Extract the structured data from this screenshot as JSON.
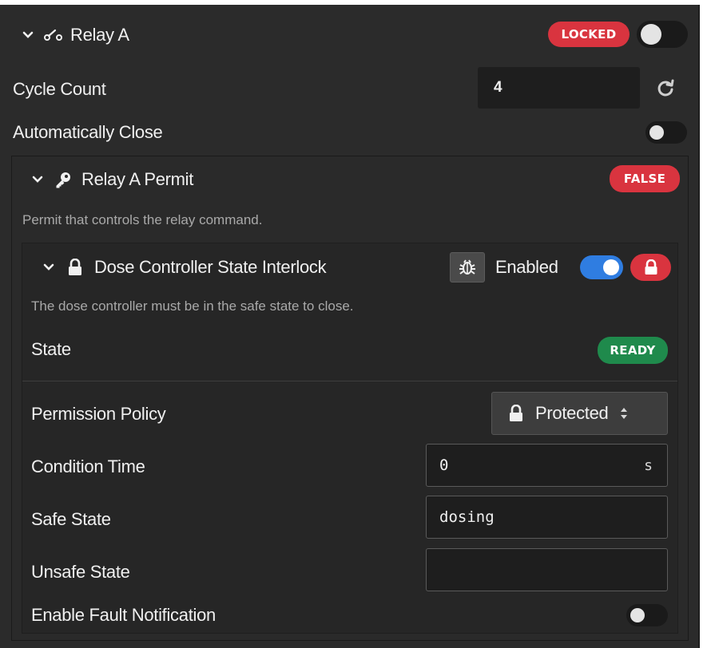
{
  "relay": {
    "title": "Relay A",
    "status_badge": "LOCKED",
    "cycle_count_label": "Cycle Count",
    "cycle_count_value": "4",
    "auto_close_label": "Automatically Close"
  },
  "permit": {
    "title": "Relay A Permit",
    "status_badge": "FALSE",
    "description": "Permit that controls the relay command."
  },
  "interlock": {
    "title": "Dose Controller State Interlock",
    "enabled_label": "Enabled",
    "description": "The dose controller must be in the safe state to close.",
    "state_label": "State",
    "state_badge": "READY",
    "permission_policy_label": "Permission Policy",
    "permission_policy_value": "Protected",
    "condition_time_label": "Condition Time",
    "condition_time_value": "0",
    "condition_time_unit": "s",
    "safe_state_label": "Safe State",
    "safe_state_value": "dosing",
    "unsafe_state_label": "Unsafe State",
    "unsafe_state_value": "",
    "fault_notification_label": "Enable Fault Notification"
  },
  "colors": {
    "background": "#2b2b2b",
    "danger": "#d9343f",
    "success": "#1f8a4c",
    "accent": "#2f7de1"
  }
}
